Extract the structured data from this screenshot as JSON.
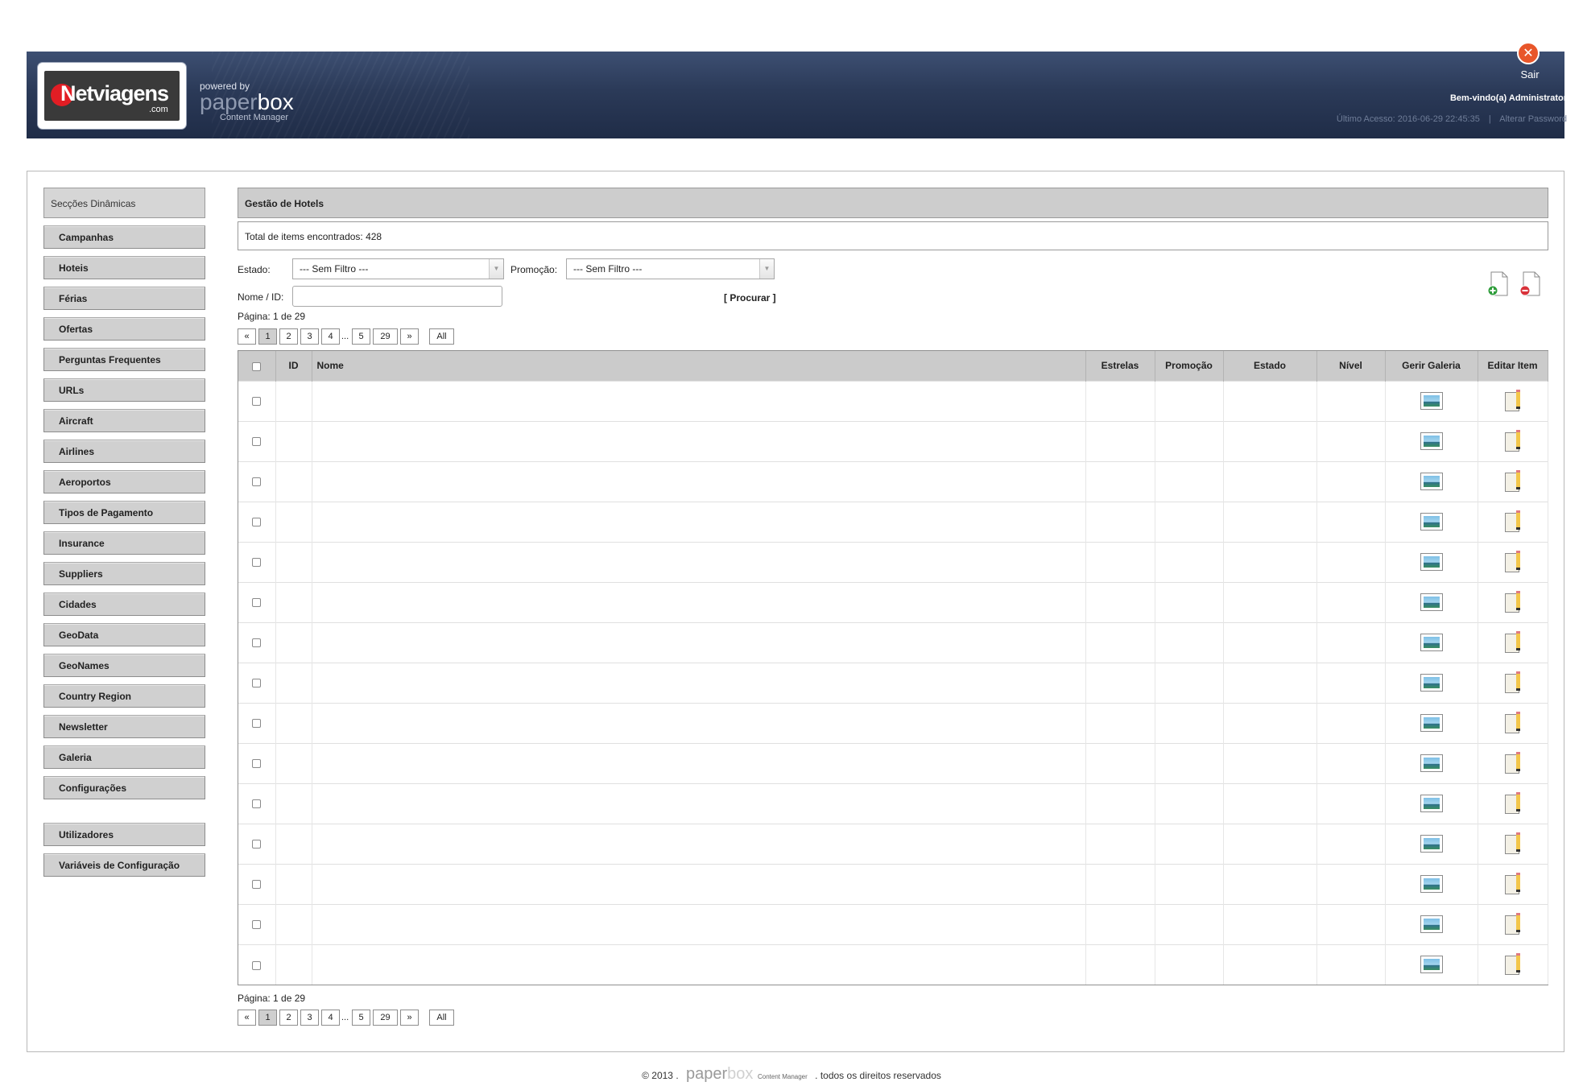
{
  "header": {
    "logo_text": "Netviagens",
    "logo_suffix": ".com",
    "powered_by": "powered by",
    "paperbox_paper": "paper",
    "paperbox_box": "box",
    "content_manager": "Content Manager",
    "logout_label": "Sair",
    "welcome_prefix": "Bem-vindo(a)",
    "welcome_user": "Administrator",
    "last_access": "Último Acesso: 2016-06-29 22:45:35",
    "separator": "|",
    "change_password": "Alterar Password"
  },
  "sidebar": {
    "title": "Secções Dinâmicas",
    "items": [
      {
        "label": "Campanhas"
      },
      {
        "label": "Hoteis"
      },
      {
        "label": "Férias"
      },
      {
        "label": "Ofertas"
      },
      {
        "label": "Perguntas Frequentes"
      },
      {
        "label": "URLs"
      },
      {
        "label": "Aircraft"
      },
      {
        "label": "Airlines"
      },
      {
        "label": "Aeroportos"
      },
      {
        "label": "Tipos de Pagamento"
      },
      {
        "label": "Insurance"
      },
      {
        "label": "Suppliers"
      },
      {
        "label": "Cidades"
      },
      {
        "label": "GeoData"
      },
      {
        "label": "GeoNames"
      },
      {
        "label": "Country Region"
      },
      {
        "label": "Newsletter"
      },
      {
        "label": "Galeria"
      },
      {
        "label": "Configurações"
      }
    ],
    "admin_items": [
      {
        "label": "Utilizadores"
      },
      {
        "label": "Variáveis de Configuração"
      }
    ]
  },
  "main": {
    "title": "Gestão de Hotels",
    "total": "Total de items encontrados: 428",
    "filters": {
      "estado_label": "Estado:",
      "estado_value": "--- Sem Filtro ---",
      "promocao_label": "Promoção:",
      "promocao_value": "--- Sem Filtro ---",
      "nome_label": "Nome / ID:",
      "nome_value": "",
      "search_label": "[ Procurar ]"
    },
    "pagination": {
      "label": "Página: 1 de 29",
      "first": "«",
      "pages": [
        "1",
        "2",
        "3",
        "4"
      ],
      "dots": "...",
      "more_pages": [
        "5",
        "29"
      ],
      "last": "»",
      "all": "All"
    },
    "table": {
      "columns": [
        "ID",
        "Nome",
        "Estrelas",
        "Promoção",
        "Estado",
        "Nível",
        "Gerir Galeria",
        "Editar Item"
      ],
      "rows": [
        {
          "id": "",
          "name": "",
          "stars": "",
          "promo": "",
          "state": "",
          "level": ""
        },
        {
          "id": "",
          "name": "",
          "stars": "",
          "promo": "",
          "state": "",
          "level": ""
        },
        {
          "id": "",
          "name": "",
          "stars": "",
          "promo": "",
          "state": "",
          "level": ""
        },
        {
          "id": "",
          "name": "",
          "stars": "",
          "promo": "",
          "state": "",
          "level": ""
        },
        {
          "id": "",
          "name": "",
          "stars": "",
          "promo": "",
          "state": "",
          "level": ""
        },
        {
          "id": "",
          "name": "",
          "stars": "",
          "promo": "",
          "state": "",
          "level": ""
        },
        {
          "id": "",
          "name": "",
          "stars": "",
          "promo": "",
          "state": "",
          "level": ""
        },
        {
          "id": "",
          "name": "",
          "stars": "",
          "promo": "",
          "state": "",
          "level": ""
        },
        {
          "id": "",
          "name": "",
          "stars": "",
          "promo": "",
          "state": "",
          "level": ""
        },
        {
          "id": "",
          "name": "",
          "stars": "",
          "promo": "",
          "state": "",
          "level": ""
        },
        {
          "id": "",
          "name": "",
          "stars": "",
          "promo": "",
          "state": "",
          "level": ""
        },
        {
          "id": "",
          "name": "",
          "stars": "",
          "promo": "",
          "state": "",
          "level": ""
        },
        {
          "id": "",
          "name": "",
          "stars": "",
          "promo": "",
          "state": "",
          "level": ""
        },
        {
          "id": "",
          "name": "",
          "stars": "",
          "promo": "",
          "state": "",
          "level": ""
        },
        {
          "id": "",
          "name": "",
          "stars": "",
          "promo": "",
          "state": "",
          "level": ""
        }
      ]
    },
    "icons": {
      "add": "add-item-icon",
      "delete": "delete-item-icon",
      "gallery": "gallery-icon",
      "edit": "edit-icon"
    }
  },
  "footer": {
    "copyright": "© 2013",
    "dot": ".",
    "brand_paper": "paper",
    "brand_box": "box",
    "brand_sub": "Content Manager",
    "rights": "todos os direitos reservados"
  },
  "colors": {
    "header_bg": "#2b3a58",
    "logo_red": "#e21d24",
    "logout_orange": "#e8562a",
    "sidebar_button": "#d0d0d0",
    "table_header": "#cbcbcb"
  }
}
